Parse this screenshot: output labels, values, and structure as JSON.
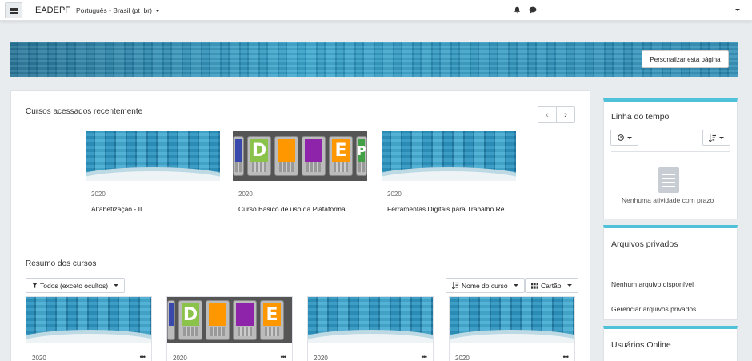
{
  "navbar": {
    "brand": "EADEPF",
    "language": "Português - Brasil (pt_br)",
    "icons": [
      "menu-icon",
      "bell-icon",
      "chat-icon"
    ]
  },
  "header": {
    "customize_label": "Personalizar esta página"
  },
  "recent": {
    "title": "Cursos acessados recentemente",
    "prev": "‹",
    "next": "›",
    "courses": [
      {
        "year": "2020",
        "name": "Alfabetização - II",
        "image": "building"
      },
      {
        "year": "2020",
        "name": "Curso Básico de uso da Plataforma",
        "image": "phones"
      },
      {
        "year": "2020",
        "name": "Ferramentas Digitais para Trabalho Re...",
        "image": "building"
      }
    ]
  },
  "overview": {
    "title": "Resumo dos cursos",
    "filter_label": "Todos (exceto ocultos)",
    "sort_label": "Nome do curso",
    "view_label": "Cartão",
    "courses": [
      {
        "year": "2020",
        "image": "building",
        "menu": "•••"
      },
      {
        "year": "2020",
        "image": "phones",
        "menu": "•••"
      },
      {
        "year": "2020",
        "image": "building",
        "menu": "•••"
      },
      {
        "year": "2020",
        "image": "building",
        "menu": "•••"
      }
    ]
  },
  "phone_letters": [
    "D",
    "",
    "",
    "E",
    "P"
  ],
  "phone_colors": [
    "#8bc34a",
    "#ff9800",
    "#8e24aa",
    "#ff9800",
    "#43a047"
  ],
  "timeline": {
    "title": "Linha do tempo",
    "empty_text": "Nenhuma atividade com prazo"
  },
  "private_files": {
    "title": "Arquivos privados",
    "empty_text": "Nenhum arquivo disponível",
    "manage_link": "Gerenciar arquivos privados..."
  },
  "online_users": {
    "title": "Usuários Online"
  },
  "colors": {
    "accent": "#4fc1d8",
    "banner": "#2a8db5",
    "background": "#e9ecef"
  }
}
